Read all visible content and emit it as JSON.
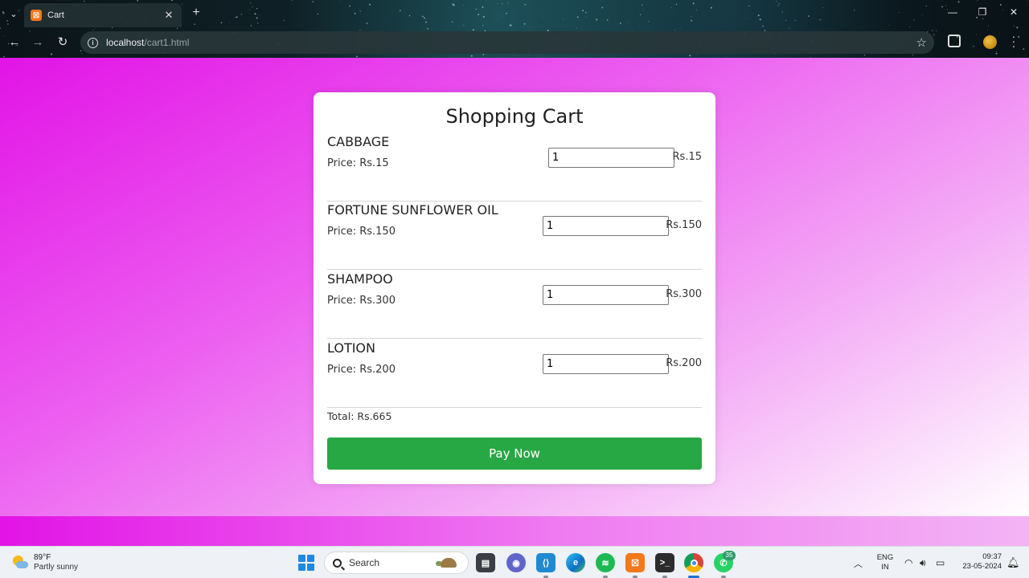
{
  "browser": {
    "tab_title": "Cart",
    "url_host": "localhost",
    "url_path": "/cart1.html"
  },
  "cart": {
    "title": "Shopping Cart",
    "items": [
      {
        "name": "CABBAGE",
        "price_text": "Price: Rs.15",
        "quantity": "1",
        "subtotal": "Rs.15"
      },
      {
        "name": "FORTUNE SUNFLOWER OIL",
        "price_text": "Price: Rs.150",
        "quantity": "1",
        "subtotal": "Rs.150"
      },
      {
        "name": "SHAMPOO",
        "price_text": "Price: Rs.300",
        "quantity": "1",
        "subtotal": "Rs.300"
      },
      {
        "name": "LOTION",
        "price_text": "Price: Rs.200",
        "quantity": "1",
        "subtotal": "Rs.200"
      }
    ],
    "total_text": "Total: Rs.665",
    "pay_button_label": "Pay Now"
  },
  "colors": {
    "pay_button": "#28a745",
    "page_gradient_start": "#e214e6",
    "page_gradient_end": "#ffffff"
  },
  "taskbar": {
    "weather_temp": "89°F",
    "weather_desc": "Partly sunny",
    "search_label": "Search",
    "lang_line1": "ENG",
    "lang_line2": "IN",
    "time": "09:37",
    "date": "23-05-2024",
    "whatsapp_badge": "35",
    "apps": [
      "file-explorer",
      "teams-chat",
      "vscode",
      "edge",
      "spotify",
      "xampp",
      "terminal",
      "chrome",
      "whatsapp"
    ]
  }
}
